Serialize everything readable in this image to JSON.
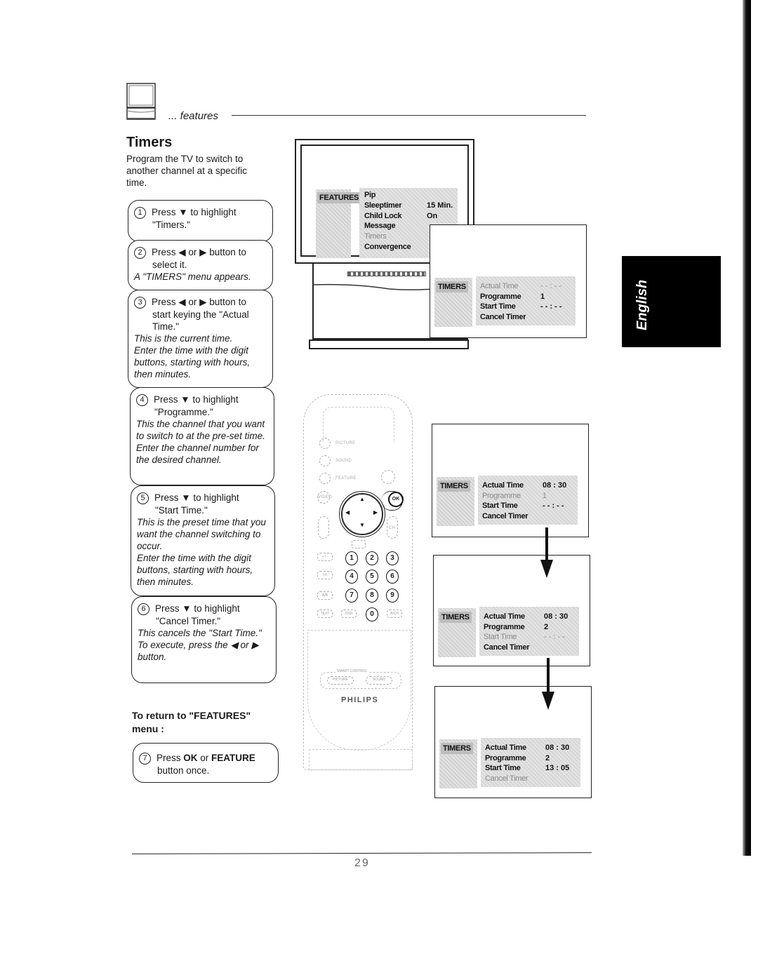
{
  "header": {
    "section_label": "... features",
    "icon": "tv-set-icon"
  },
  "title": "Timers",
  "intro": "Program the TV to switch to another channel at a specific time.",
  "steps": [
    {
      "num": "1",
      "main": "Press ▼ to highlight",
      "cont": "\"Timers.\"",
      "notes": []
    },
    {
      "num": "2",
      "main": "Press ◀ or ▶ button to",
      "cont": "select it.",
      "notes": [
        "A \"TIMERS\" menu appears."
      ]
    },
    {
      "num": "3",
      "main": "Press ◀ or ▶ button to",
      "cont": "start keying the \"Actual Time.\"",
      "notes": [
        "This is the current time.",
        "Enter the time with the digit buttons, starting with hours, then minutes."
      ]
    },
    {
      "num": "4",
      "main": "Press ▼ to highlight",
      "cont": "\"Programme.\"",
      "notes": [
        "This the channel that you want to switch to at the pre-set time.",
        "Enter the channel number for the desired channel."
      ]
    },
    {
      "num": "5",
      "main": "Press ▼ to highlight",
      "cont": "\"Start Time.\"",
      "notes": [
        "This is the preset time that you want the channel switching to occur.",
        "Enter the time with the digit buttons, starting with hours, then minutes."
      ]
    },
    {
      "num": "6",
      "main": "Press ▼ to highlight",
      "cont": "\"Cancel Timer.\"",
      "notes": [
        "This cancels the \"Start Time.\"",
        "To execute, press the ◀ or ▶ button."
      ]
    }
  ],
  "return_section": {
    "heading": "To return to \"FEATURES\" menu :",
    "step": {
      "num": "7",
      "prefix": "Press ",
      "ok": "OK",
      "or": " or ",
      "feature": "FEATURE",
      "suffix": "button once."
    }
  },
  "features_menu": {
    "tag": "FEATURES",
    "items": [
      {
        "label": "Pip",
        "value": "",
        "highlighted": false
      },
      {
        "label": "Sleeptimer",
        "value": "15 Min.",
        "highlighted": false
      },
      {
        "label": "Child Lock",
        "value": "On",
        "highlighted": false
      },
      {
        "label": "Message",
        "value": "",
        "highlighted": false
      },
      {
        "label": "Timers",
        "value": "",
        "highlighted": true
      },
      {
        "label": "Convergence",
        "value": "",
        "highlighted": false
      }
    ]
  },
  "timers_menus": [
    {
      "tag": "TIMERS",
      "items": [
        {
          "label": "Actual Time",
          "value": "- - : - -",
          "highlighted": true
        },
        {
          "label": "Programme",
          "value": "1",
          "highlighted": false
        },
        {
          "label": "Start Time",
          "value": "- - : - -",
          "highlighted": false
        },
        {
          "label": "Cancel Timer",
          "value": "",
          "highlighted": false
        }
      ]
    },
    {
      "tag": "TIMERS",
      "items": [
        {
          "label": "Actual Time",
          "value": "08 : 30",
          "highlighted": false
        },
        {
          "label": "Programme",
          "value": "1",
          "highlighted": true
        },
        {
          "label": "Start Time",
          "value": "- - : - -",
          "highlighted": false
        },
        {
          "label": "Cancel Timer",
          "value": "",
          "highlighted": false
        }
      ]
    },
    {
      "tag": "TIMERS",
      "items": [
        {
          "label": "Actual Time",
          "value": "08 : 30",
          "highlighted": false
        },
        {
          "label": "Programme",
          "value": "2",
          "highlighted": false
        },
        {
          "label": "Start Time",
          "value": "- - : - -",
          "highlighted": true
        },
        {
          "label": "Cancel Timer",
          "value": "",
          "highlighted": false
        }
      ]
    },
    {
      "tag": "TIMERS",
      "items": [
        {
          "label": "Actual Time",
          "value": "08 : 30",
          "highlighted": false
        },
        {
          "label": "Programme",
          "value": "2",
          "highlighted": false
        },
        {
          "label": "Start Time",
          "value": "13 : 05",
          "highlighted": false
        },
        {
          "label": "Cancel Timer",
          "value": "",
          "highlighted": true
        }
      ]
    }
  ],
  "remote": {
    "brand": "PHILIPS",
    "menu_buttons": [
      "PICTURE",
      "SOUND",
      "FEATURE"
    ],
    "ok_label": "OK",
    "video_label": "VIDEO",
    "ch_label": "CH",
    "digits": [
      "1",
      "2",
      "3",
      "4",
      "5",
      "6",
      "7",
      "8",
      "9",
      "0"
    ],
    "side_labels": [
      "+ / -",
      "I-II",
      "A/B",
      "TEXT",
      "OSD",
      "A/CH"
    ],
    "smart_control_label": "SMART CONTROL",
    "smart_buttons": [
      "PICTURE",
      "SOUND"
    ]
  },
  "language_tab": "English",
  "page_number": "29"
}
